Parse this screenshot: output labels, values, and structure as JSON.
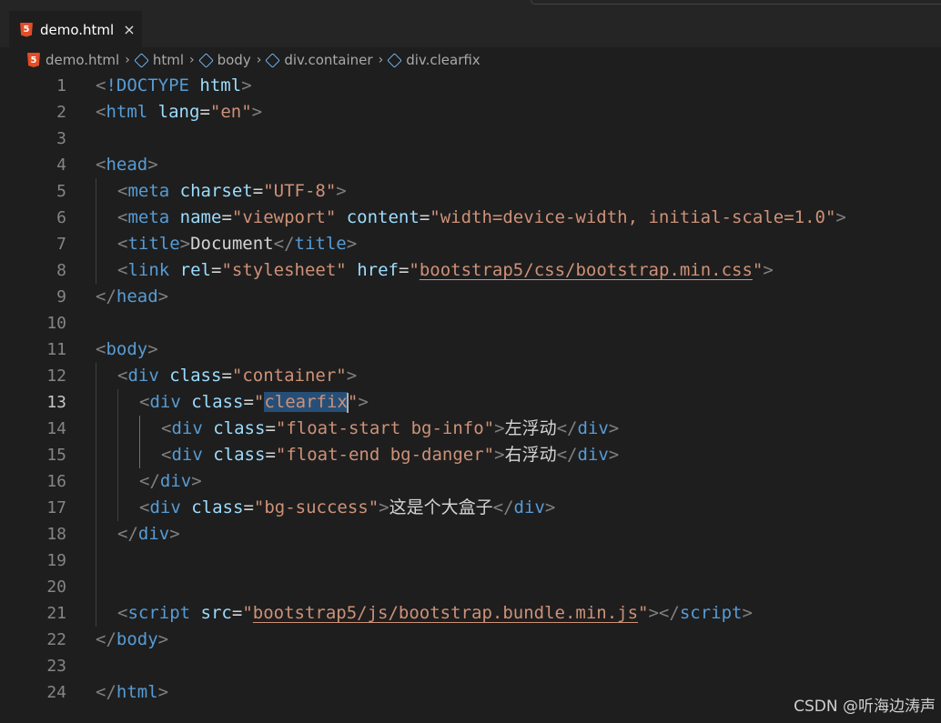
{
  "tab": {
    "title": "demo.html",
    "close_glyph": "×",
    "file_icon": "html5-icon"
  },
  "breadcrumb": [
    {
      "label": "demo.html",
      "icon": "html5-icon"
    },
    {
      "label": "html",
      "icon": "element-icon"
    },
    {
      "label": "body",
      "icon": "element-icon"
    },
    {
      "label": "div.container",
      "icon": "element-icon"
    },
    {
      "label": "div.clearfix",
      "icon": "element-icon"
    }
  ],
  "active_line": 13,
  "colors": {
    "tag": "#569cd6",
    "attribute": "#9cdcfe",
    "string": "#ce9178",
    "punctuation": "#808080",
    "text": "#d4d4d4",
    "selection": "#264f78"
  },
  "lines": [
    {
      "n": 1,
      "indent": 0,
      "tokens": [
        [
          "punc",
          "<"
        ],
        [
          "tag",
          "!DOCTYPE"
        ],
        [
          "text",
          " "
        ],
        [
          "attr",
          "html"
        ],
        [
          "punc",
          ">"
        ]
      ]
    },
    {
      "n": 2,
      "indent": 0,
      "tokens": [
        [
          "punc",
          "<"
        ],
        [
          "tag",
          "html"
        ],
        [
          "text",
          " "
        ],
        [
          "attr",
          "lang"
        ],
        [
          "text",
          "="
        ],
        [
          "str",
          "\"en\""
        ],
        [
          "punc",
          ">"
        ]
      ]
    },
    {
      "n": 3,
      "indent": 0,
      "tokens": []
    },
    {
      "n": 4,
      "indent": 0,
      "tokens": [
        [
          "punc",
          "<"
        ],
        [
          "tag",
          "head"
        ],
        [
          "punc",
          ">"
        ]
      ]
    },
    {
      "n": 5,
      "indent": 1,
      "tokens": [
        [
          "punc",
          "<"
        ],
        [
          "tag",
          "meta"
        ],
        [
          "text",
          " "
        ],
        [
          "attr",
          "charset"
        ],
        [
          "text",
          "="
        ],
        [
          "str",
          "\"UTF-8\""
        ],
        [
          "punc",
          ">"
        ]
      ]
    },
    {
      "n": 6,
      "indent": 1,
      "tokens": [
        [
          "punc",
          "<"
        ],
        [
          "tag",
          "meta"
        ],
        [
          "text",
          " "
        ],
        [
          "attr",
          "name"
        ],
        [
          "text",
          "="
        ],
        [
          "str",
          "\"viewport\""
        ],
        [
          "text",
          " "
        ],
        [
          "attr",
          "content"
        ],
        [
          "text",
          "="
        ],
        [
          "str",
          "\"width=device-width, initial-scale=1.0\""
        ],
        [
          "punc",
          ">"
        ]
      ]
    },
    {
      "n": 7,
      "indent": 1,
      "tokens": [
        [
          "punc",
          "<"
        ],
        [
          "tag",
          "title"
        ],
        [
          "punc",
          ">"
        ],
        [
          "text",
          "Document"
        ],
        [
          "punc",
          "</"
        ],
        [
          "tag",
          "title"
        ],
        [
          "punc",
          ">"
        ]
      ]
    },
    {
      "n": 8,
      "indent": 1,
      "tokens": [
        [
          "punc",
          "<"
        ],
        [
          "tag",
          "link"
        ],
        [
          "text",
          " "
        ],
        [
          "attr",
          "rel"
        ],
        [
          "text",
          "="
        ],
        [
          "str",
          "\"stylesheet\""
        ],
        [
          "text",
          " "
        ],
        [
          "attr",
          "href"
        ],
        [
          "text",
          "="
        ],
        [
          "str",
          "\""
        ],
        [
          "strlink",
          "bootstrap5/css/bootstrap.min.css"
        ],
        [
          "str",
          "\""
        ],
        [
          "punc",
          ">"
        ]
      ]
    },
    {
      "n": 9,
      "indent": 0,
      "tokens": [
        [
          "punc",
          "</"
        ],
        [
          "tag",
          "head"
        ],
        [
          "punc",
          ">"
        ]
      ]
    },
    {
      "n": 10,
      "indent": 0,
      "tokens": []
    },
    {
      "n": 11,
      "indent": 0,
      "tokens": [
        [
          "punc",
          "<"
        ],
        [
          "tag",
          "body"
        ],
        [
          "punc",
          ">"
        ]
      ]
    },
    {
      "n": 12,
      "indent": 1,
      "tokens": [
        [
          "punc",
          "<"
        ],
        [
          "tag",
          "div"
        ],
        [
          "text",
          " "
        ],
        [
          "attr",
          "class"
        ],
        [
          "text",
          "="
        ],
        [
          "str",
          "\"container\""
        ],
        [
          "punc",
          ">"
        ]
      ]
    },
    {
      "n": 13,
      "indent": 2,
      "tokens": [
        [
          "punc",
          "<"
        ],
        [
          "tag",
          "div"
        ],
        [
          "text",
          " "
        ],
        [
          "attr",
          "class"
        ],
        [
          "text",
          "="
        ],
        [
          "str",
          "\""
        ],
        [
          "strsel",
          "clearfix"
        ],
        [
          "cursor",
          ""
        ],
        [
          "str",
          "\""
        ],
        [
          "punc",
          ">"
        ]
      ]
    },
    {
      "n": 14,
      "indent": 3,
      "tokens": [
        [
          "punc",
          "<"
        ],
        [
          "tag",
          "div"
        ],
        [
          "text",
          " "
        ],
        [
          "attr",
          "class"
        ],
        [
          "text",
          "="
        ],
        [
          "str",
          "\"float-start bg-info\""
        ],
        [
          "punc",
          ">"
        ],
        [
          "text",
          "左浮动"
        ],
        [
          "punc",
          "</"
        ],
        [
          "tag",
          "div"
        ],
        [
          "punc",
          ">"
        ]
      ]
    },
    {
      "n": 15,
      "indent": 3,
      "tokens": [
        [
          "punc",
          "<"
        ],
        [
          "tag",
          "div"
        ],
        [
          "text",
          " "
        ],
        [
          "attr",
          "class"
        ],
        [
          "text",
          "="
        ],
        [
          "str",
          "\"float-end bg-danger\""
        ],
        [
          "punc",
          ">"
        ],
        [
          "text",
          "右浮动"
        ],
        [
          "punc",
          "</"
        ],
        [
          "tag",
          "div"
        ],
        [
          "punc",
          ">"
        ]
      ]
    },
    {
      "n": 16,
      "indent": 2,
      "tokens": [
        [
          "punc",
          "</"
        ],
        [
          "tag",
          "div"
        ],
        [
          "punc",
          ">"
        ]
      ]
    },
    {
      "n": 17,
      "indent": 2,
      "tokens": [
        [
          "punc",
          "<"
        ],
        [
          "tag",
          "div"
        ],
        [
          "text",
          " "
        ],
        [
          "attr",
          "class"
        ],
        [
          "text",
          "="
        ],
        [
          "str",
          "\"bg-success\""
        ],
        [
          "punc",
          ">"
        ],
        [
          "text",
          "这是个大盒子"
        ],
        [
          "punc",
          "</"
        ],
        [
          "tag",
          "div"
        ],
        [
          "punc",
          ">"
        ]
      ]
    },
    {
      "n": 18,
      "indent": 1,
      "tokens": [
        [
          "punc",
          "</"
        ],
        [
          "tag",
          "div"
        ],
        [
          "punc",
          ">"
        ]
      ]
    },
    {
      "n": 19,
      "indent": 1,
      "tokens": []
    },
    {
      "n": 20,
      "indent": 1,
      "tokens": []
    },
    {
      "n": 21,
      "indent": 1,
      "tokens": [
        [
          "punc",
          "<"
        ],
        [
          "tag",
          "script"
        ],
        [
          "text",
          " "
        ],
        [
          "attr",
          "src"
        ],
        [
          "text",
          "="
        ],
        [
          "str",
          "\""
        ],
        [
          "strlink",
          "bootstrap5/js/bootstrap.bundle.min.js"
        ],
        [
          "str",
          "\""
        ],
        [
          "punc",
          "></"
        ],
        [
          "tag",
          "script"
        ],
        [
          "punc",
          ">"
        ]
      ]
    },
    {
      "n": 22,
      "indent": 0,
      "tokens": [
        [
          "punc",
          "</"
        ],
        [
          "tag",
          "body"
        ],
        [
          "punc",
          ">"
        ]
      ]
    },
    {
      "n": 23,
      "indent": 0,
      "tokens": []
    },
    {
      "n": 24,
      "indent": 0,
      "tokens": [
        [
          "punc",
          "</"
        ],
        [
          "tag",
          "html"
        ],
        [
          "punc",
          ">"
        ]
      ]
    }
  ],
  "watermark": "CSDN @听海边涛声"
}
